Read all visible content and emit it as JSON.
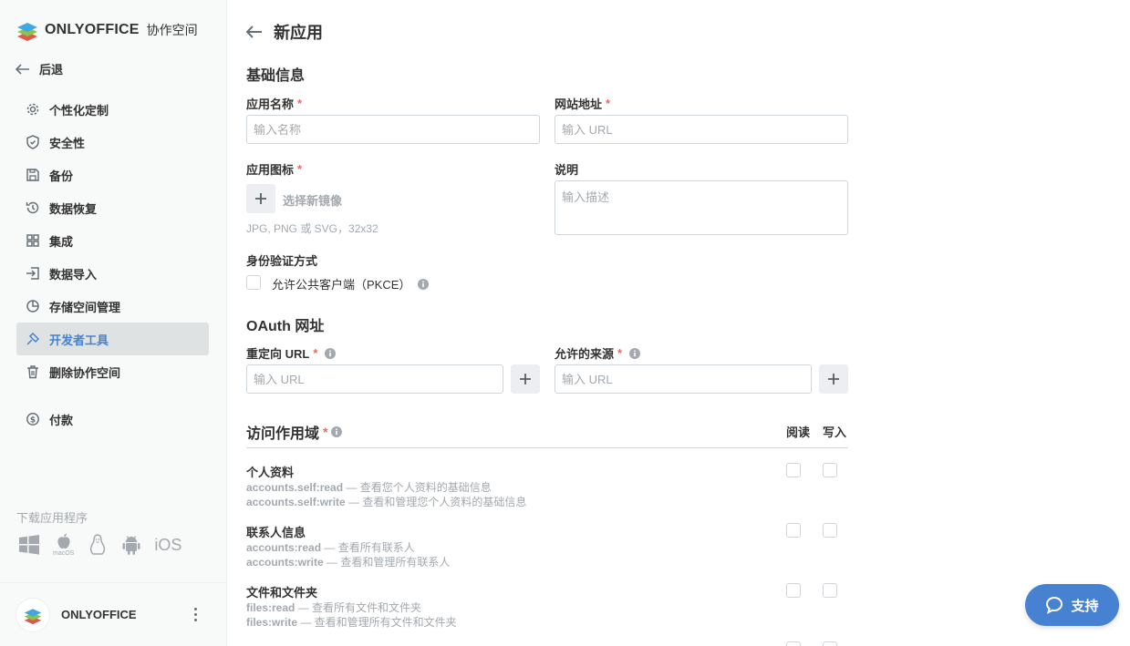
{
  "brand": {
    "name": "ONLYOFFICE",
    "suffix": "协作空间"
  },
  "sidebar": {
    "back_label": "后退",
    "items": [
      {
        "label": "个性化定制",
        "icon": "gear-icon"
      },
      {
        "label": "安全性",
        "icon": "shield-icon"
      },
      {
        "label": "备份",
        "icon": "save-icon"
      },
      {
        "label": "数据恢复",
        "icon": "restore-icon"
      },
      {
        "label": "集成",
        "icon": "grid-icon"
      },
      {
        "label": "数据导入",
        "icon": "import-icon"
      },
      {
        "label": "存储空间管理",
        "icon": "pie-icon"
      },
      {
        "label": "开发者工具",
        "icon": "devtools-icon",
        "active": true
      },
      {
        "label": "删除协作空间",
        "icon": "trash-icon"
      },
      {
        "label": "付款",
        "icon": "payment-icon"
      }
    ],
    "download_title": "下载应用程序",
    "download_ios": "iOS",
    "download_macos": "macOS",
    "profile_name": "ONLYOFFICE"
  },
  "page": {
    "title": "新应用",
    "basic_section": "基础信息",
    "app_name_label": "应用名称",
    "app_name_placeholder": "输入名称",
    "website_label": "网站地址",
    "website_placeholder": "输入 URL",
    "icon_label": "应用图标",
    "choose_image": "选择新镜像",
    "icon_hint": "JPG, PNG 或 SVG，32x32",
    "description_label": "说明",
    "description_placeholder": "输入描述",
    "auth_label": "身份验证方式",
    "pkce_label": "允许公共客户端（PKCE）",
    "oauth_section": "OAuth 网址",
    "redirect_label": "重定向 URL",
    "redirect_placeholder": "输入 URL",
    "origins_label": "允许的来源",
    "origins_placeholder": "输入 URL",
    "scope_section": "访问作用域",
    "read_col": "阅读",
    "write_col": "写入",
    "required_mark": "*"
  },
  "scopes": [
    {
      "title": "个人资料",
      "read_key": "accounts.self:read",
      "read_desc": " — 查看您个人资料的基础信息",
      "write_key": "accounts.self:write",
      "write_desc": " — 查看和管理您个人资料的基础信息"
    },
    {
      "title": "联系人信息",
      "read_key": "accounts:read",
      "read_desc": " — 查看所有联系人",
      "write_key": "accounts:write",
      "write_desc": " — 查看和管理所有联系人"
    },
    {
      "title": "文件和文件夹",
      "read_key": "files:read",
      "read_desc": " — 查看所有文件和文件夹",
      "write_key": "files:write",
      "write_desc": " — 查看和管理所有文件和文件夹"
    }
  ],
  "support_label": "支持",
  "colors": {
    "accent": "#4781d1",
    "required": "#f2675a",
    "muted": "#a3a9ae"
  }
}
